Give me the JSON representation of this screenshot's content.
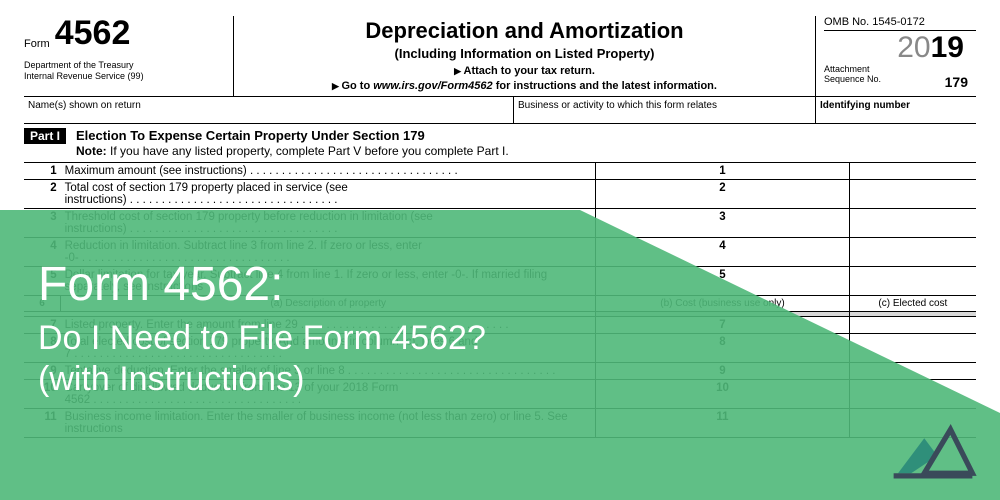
{
  "header": {
    "form_label": "Form",
    "form_number": "4562",
    "dept_line1": "Department of the Treasury",
    "dept_line2": "Internal Revenue Service   (99)",
    "main_title": "Depreciation and Amortization",
    "subtitle": "(Including Information on Listed Property)",
    "attach": "Attach to your tax return.",
    "goto_prefix": "Go to ",
    "goto_url": "www.irs.gov/Form4562",
    "goto_suffix": " for instructions and the latest information.",
    "omb": "OMB No. 1545-0172",
    "year_20": "20",
    "year_19": "19",
    "seq_label": "Attachment",
    "seq_label2": "Sequence No.",
    "seq_num": "179"
  },
  "name_row": {
    "name_label": "Name(s) shown on return",
    "business_label": "Business or activity to which this form relates",
    "id_label": "Identifying number"
  },
  "part1": {
    "badge": "Part I",
    "title": "Election To Expense Certain Property Under Section 179",
    "note_bold": "Note:",
    "note_text": " If you have any listed property, complete Part V before you complete Part I."
  },
  "lines": [
    {
      "num": "1",
      "desc": "Maximum amount (see instructions)",
      "box": "1"
    },
    {
      "num": "2",
      "desc": "Total cost of section 179 property placed in service (see instructions)",
      "box": "2"
    },
    {
      "num": "3",
      "desc": "Threshold cost of section 179 property before reduction in limitation (see instructions)",
      "box": "3"
    },
    {
      "num": "4",
      "desc": "Reduction in limitation. Subtract line 3 from line 2. If zero or less, enter -0-",
      "box": "4"
    },
    {
      "num": "5",
      "desc": "Dollar limitation for tax year. Subtract line 4 from line 1. If zero or less, enter -0-. If married filing separately, see instructions",
      "box": "5"
    }
  ],
  "line6": {
    "num": "6",
    "col_a": "(a) Description of property",
    "col_b": "(b) Cost (business use only)",
    "col_c": "(c) Elected cost"
  },
  "line7": {
    "num": "7",
    "desc": "Listed property. Enter the amount from line 29",
    "box": "7"
  },
  "lines_bottom": [
    {
      "num": "8",
      "desc": "Total elected cost of section 179 property. Add amounts in column (c), lines 6 and 7",
      "box": "8"
    },
    {
      "num": "9",
      "desc": "Tentative deduction. Enter the smaller of line 5 or line 8",
      "box": "9"
    },
    {
      "num": "10",
      "desc": "Carryover of disallowed deduction from line 13 of your 2018 Form 4562",
      "box": "10"
    },
    {
      "num": "11",
      "desc": "Business income limitation. Enter the smaller of business income (not less than zero) or line 5. See instructions",
      "box": "11"
    }
  ],
  "smaller_word": "smaller",
  "overlay": {
    "title": "Form 4562:",
    "sub_line1": "Do I Need to File Form 4562?",
    "sub_line2": "(with Instructions)"
  }
}
